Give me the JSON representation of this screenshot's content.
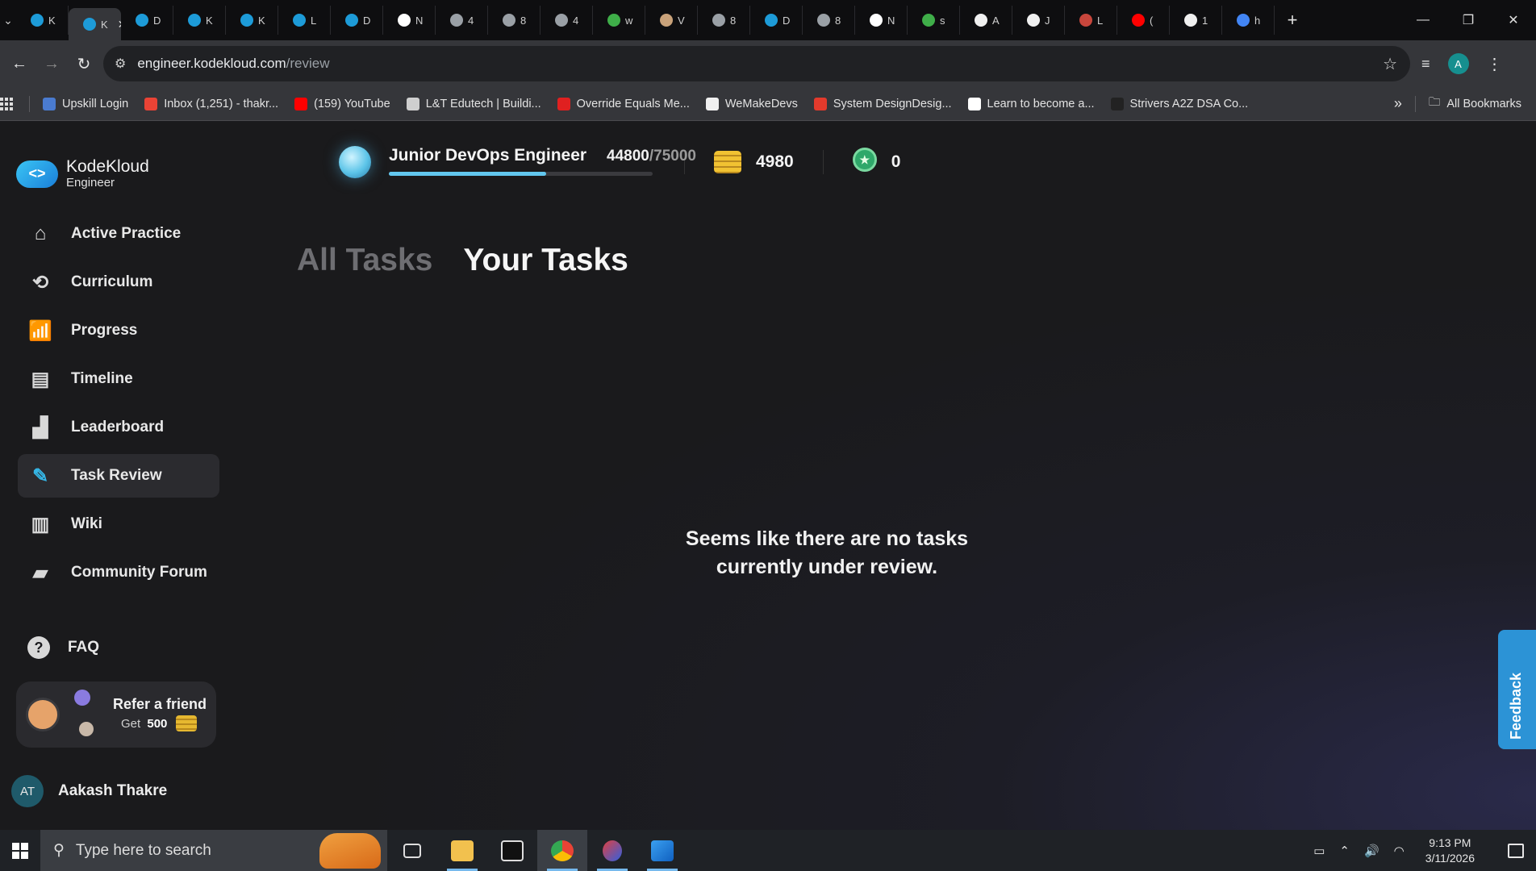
{
  "browser": {
    "tabs": [
      {
        "label": "K",
        "color": "#1d9bd8"
      },
      {
        "label": "K",
        "color": "#1d9bd8",
        "active": true
      },
      {
        "label": "D",
        "color": "#1d9bd8"
      },
      {
        "label": "K",
        "color": "#1d9bd8"
      },
      {
        "label": "K",
        "color": "#1d9bd8"
      },
      {
        "label": "L",
        "color": "#1d9bd8"
      },
      {
        "label": "D",
        "color": "#1d9bd8"
      },
      {
        "label": "N",
        "color": "#ffffff"
      },
      {
        "label": "4",
        "color": "#9aa0a6"
      },
      {
        "label": "8",
        "color": "#9aa0a6"
      },
      {
        "label": "4",
        "color": "#9aa0a6"
      },
      {
        "label": "w",
        "color": "#3fae49"
      },
      {
        "label": "V",
        "color": "#c9a27a"
      },
      {
        "label": "8",
        "color": "#9aa0a6"
      },
      {
        "label": "D",
        "color": "#1d9bd8"
      },
      {
        "label": "8",
        "color": "#9aa0a6"
      },
      {
        "label": "N",
        "color": "#ffffff"
      },
      {
        "label": "s",
        "color": "#3fae49"
      },
      {
        "label": "A",
        "color": "#f0f0f0"
      },
      {
        "label": "J",
        "color": "#f0f0f0"
      },
      {
        "label": "L",
        "color": "#c8463c"
      },
      {
        "label": "(",
        "color": "#ff0000"
      },
      {
        "label": "1",
        "color": "#f0f0f0"
      },
      {
        "label": "h",
        "color": "#4285f4"
      }
    ],
    "url_host": "engineer.kodekloud.com",
    "url_path": "/review",
    "profile_initial": "A",
    "bookmarks": [
      {
        "label": "Upskill Login",
        "color": "#4a7bd0"
      },
      {
        "label": "Inbox (1,251) - thakr...",
        "color": "#ea4335"
      },
      {
        "label": "(159) YouTube",
        "color": "#ff0000"
      },
      {
        "label": "L&T Edutech | Buildi...",
        "color": "#cfcfcf"
      },
      {
        "label": "Override Equals Me...",
        "color": "#e02020"
      },
      {
        "label": "WeMakeDevs",
        "color": "#f0f0f0"
      },
      {
        "label": "System DesignDesig...",
        "color": "#e33a2c"
      },
      {
        "label": "Learn to become a...",
        "color": "#ffffff"
      },
      {
        "label": "Strivers A2Z DSA Co...",
        "color": "#222222"
      }
    ],
    "all_bookmarks": "All Bookmarks"
  },
  "sidebar": {
    "brand": "KodeKloud",
    "brand_sub": "Engineer",
    "items": [
      {
        "label": "Active Practice",
        "icon": "home-icon",
        "glyph": "⌂"
      },
      {
        "label": "Curriculum",
        "icon": "route-icon",
        "glyph": "⟲"
      },
      {
        "label": "Progress",
        "icon": "chart-icon",
        "glyph": "📶"
      },
      {
        "label": "Timeline",
        "icon": "film-icon",
        "glyph": "▤"
      },
      {
        "label": "Leaderboard",
        "icon": "podium-icon",
        "glyph": "▟"
      },
      {
        "label": "Task Review",
        "icon": "review-icon",
        "glyph": "✎",
        "active": true
      },
      {
        "label": "Wiki",
        "icon": "book-icon",
        "glyph": "▥"
      },
      {
        "label": "Community Forum",
        "icon": "chat-icon",
        "glyph": "▰"
      }
    ],
    "faq": "FAQ",
    "refer_title": "Refer a friend",
    "refer_prefix": "Get",
    "refer_amount": "500",
    "user_initials": "AT",
    "user_name": "Aakash Thakre"
  },
  "header": {
    "rank": "Junior DevOps Engineer",
    "xp_current": "44800",
    "xp_total": "/75000",
    "xp_progress": 0.597,
    "coins": "4980",
    "badges": "0"
  },
  "main": {
    "tab_all": "All Tasks",
    "tab_yours": "Your Tasks",
    "empty_line1": "Seems like there are no tasks",
    "empty_line2": "currently under review."
  },
  "feedback": "Feedback",
  "taskbar": {
    "search_placeholder": "Type here to search",
    "time": "9:13 PM",
    "date": "3/11/2026"
  }
}
